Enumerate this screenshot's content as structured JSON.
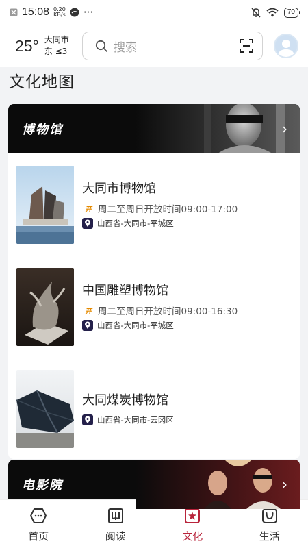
{
  "status_bar": {
    "time": "15:08",
    "net_speed_value": "0.20",
    "net_speed_unit": "KB/s",
    "more": "···",
    "battery": "70"
  },
  "header": {
    "temperature": "25°",
    "city": "大同市",
    "wind": "东 ≤3",
    "search_placeholder": "搜索"
  },
  "page_title": "文化地图",
  "museum_section": {
    "title": "博物馆",
    "items": [
      {
        "name": "大同市博物馆",
        "hours": "周二至周日开放时间09:00-17:00",
        "address": "山西省-大同市-平城区"
      },
      {
        "name": "中国雕塑博物馆",
        "hours": "周二至周日开放时间09:00-16:30",
        "address": "山西省-大同市-平城区"
      },
      {
        "name": "大同煤炭博物馆",
        "address": "山西省-大同市-云冈区"
      }
    ]
  },
  "cinema_section": {
    "title": "电影院"
  },
  "bottom_nav": [
    {
      "label": "首页",
      "icon": "home-icon"
    },
    {
      "label": "阅读",
      "icon": "book-icon"
    },
    {
      "label": "文化",
      "icon": "culture-icon",
      "active": true
    },
    {
      "label": "生活",
      "icon": "life-icon"
    }
  ],
  "colors": {
    "accent": "#b8243b",
    "banner_bg": "#0b0b0b",
    "location_icon_bg": "#24204a",
    "open_icon": "#e58a00"
  }
}
